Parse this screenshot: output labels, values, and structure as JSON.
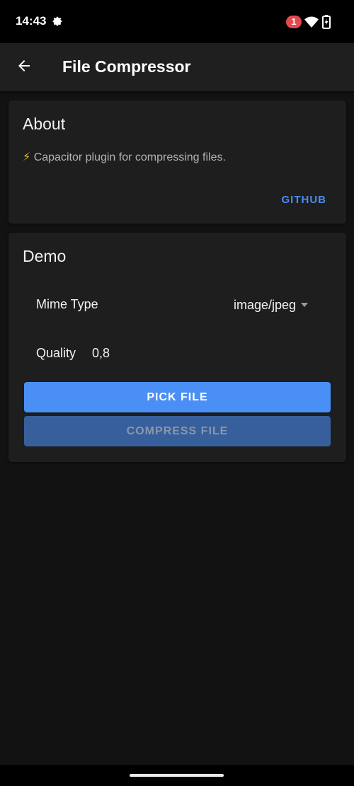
{
  "status_bar": {
    "time": "14:43",
    "notification_count": "1",
    "icons": [
      "gear-icon",
      "wifi-icon",
      "battery-icon"
    ]
  },
  "toolbar": {
    "title": "File Compressor",
    "back_icon": "arrow-left-icon"
  },
  "about": {
    "title": "About",
    "description_icon": "⚡",
    "description": "Capacitor plugin for compressing files.",
    "link_label": "GITHUB"
  },
  "demo": {
    "title": "Demo",
    "mime_type_label": "Mime Type",
    "mime_type_value": "image/jpeg",
    "quality_label": "Quality",
    "quality_value": "0,8",
    "pick_button": "PICK FILE",
    "compress_button": "COMPRESS FILE"
  },
  "colors": {
    "accent": "#4a8ff5",
    "accent_disabled": "#375f9c",
    "background": "#121212",
    "card": "#1e1e1e",
    "badge": "#e5484d"
  }
}
